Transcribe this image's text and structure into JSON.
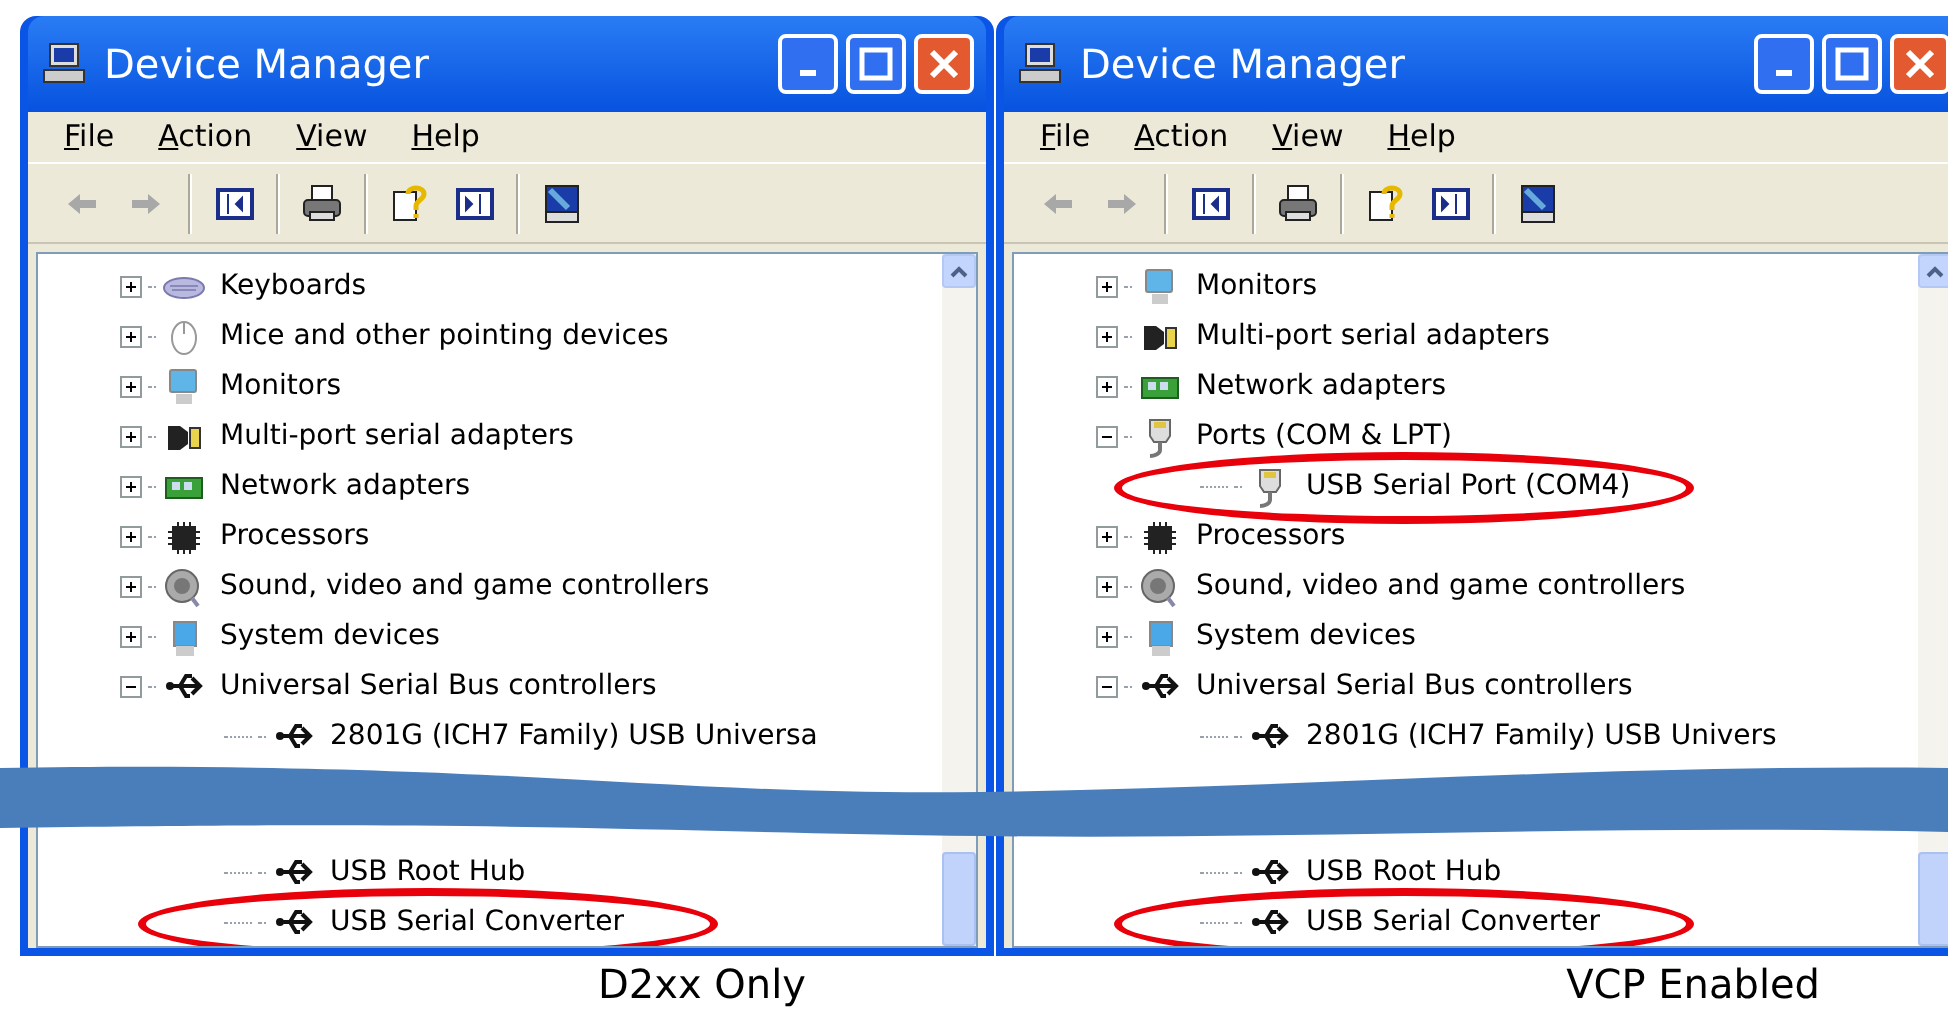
{
  "windows": [
    {
      "title": "Device Manager",
      "menu": [
        "File",
        "Action",
        "View",
        "Help"
      ],
      "tree": [
        {
          "label": "Keyboards",
          "kind": "keyboard",
          "expanded": false
        },
        {
          "label": "Mice and other pointing devices",
          "kind": "mouse",
          "expanded": false
        },
        {
          "label": "Monitors",
          "kind": "monitor",
          "expanded": false
        },
        {
          "label": "Multi-port serial adapters",
          "kind": "serial",
          "expanded": false
        },
        {
          "label": "Network adapters",
          "kind": "network",
          "expanded": false
        },
        {
          "label": "Processors",
          "kind": "processor",
          "expanded": false
        },
        {
          "label": "Sound, video and game controllers",
          "kind": "sound",
          "expanded": false
        },
        {
          "label": "System devices",
          "kind": "system",
          "expanded": false
        },
        {
          "label": "Universal Serial Bus controllers",
          "kind": "usb",
          "expanded": true,
          "children": [
            {
              "label": "2801G (ICH7 Family) USB Universa",
              "kind": "usb",
              "highlighted": false
            }
          ]
        }
      ],
      "tree_continued": [
        {
          "label": "USB Root Hub",
          "kind": "usb",
          "highlighted": false
        },
        {
          "label": "USB Serial Converter",
          "kind": "usb",
          "highlighted": true
        }
      ],
      "caption": "D2xx Only"
    },
    {
      "title": "Device Manager",
      "menu": [
        "File",
        "Action",
        "View",
        "Help"
      ],
      "tree": [
        {
          "label": "Monitors",
          "kind": "monitor",
          "expanded": false
        },
        {
          "label": "Multi-port serial adapters",
          "kind": "serial",
          "expanded": false
        },
        {
          "label": "Network adapters",
          "kind": "network",
          "expanded": false
        },
        {
          "label": "Ports (COM & LPT)",
          "kind": "port",
          "expanded": true,
          "children": [
            {
              "label": "USB Serial Port (COM4)",
              "kind": "port",
              "highlighted": true
            }
          ]
        },
        {
          "label": "Processors",
          "kind": "processor",
          "expanded": false
        },
        {
          "label": "Sound, video and game controllers",
          "kind": "sound",
          "expanded": false
        },
        {
          "label": "System devices",
          "kind": "system",
          "expanded": false
        },
        {
          "label": "Universal Serial Bus controllers",
          "kind": "usb",
          "expanded": true,
          "children": [
            {
              "label": "2801G (ICH7 Family) USB Univers",
              "kind": "usb",
              "highlighted": false
            }
          ]
        }
      ],
      "tree_continued": [
        {
          "label": "USB Root Hub",
          "kind": "usb",
          "highlighted": false
        },
        {
          "label": "USB Serial Converter",
          "kind": "usb",
          "highlighted": true
        }
      ],
      "caption": "VCP Enabled"
    }
  ]
}
